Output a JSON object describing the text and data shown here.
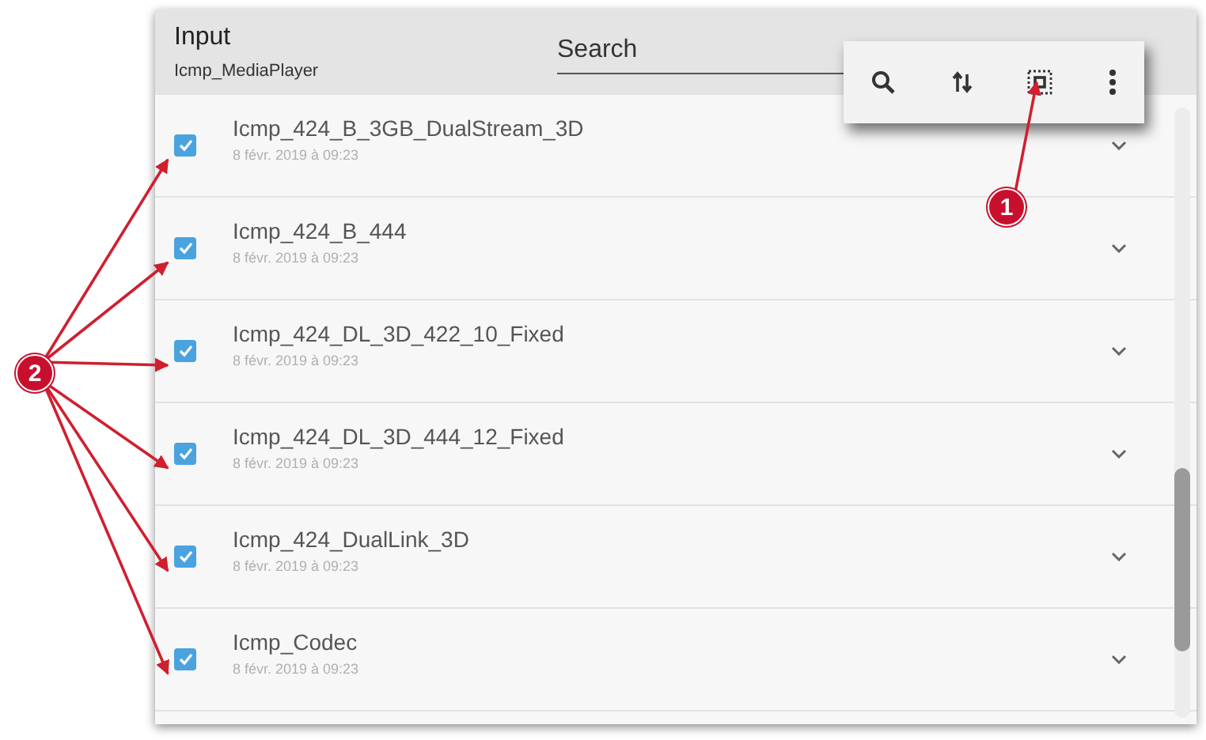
{
  "header": {
    "title": "Input",
    "subtitle": "Icmp_MediaPlayer"
  },
  "search": {
    "placeholder": "Search"
  },
  "toolbar": [
    {
      "kind": "search"
    },
    {
      "kind": "sort"
    },
    {
      "kind": "select"
    },
    {
      "kind": "more"
    }
  ],
  "items": [
    {
      "name": "Icmp_424_B_3GB_DualStream_3D",
      "date": "8 févr. 2019 à 09:23",
      "checked": true
    },
    {
      "name": "Icmp_424_B_444",
      "date": "8 févr. 2019 à 09:23",
      "checked": true
    },
    {
      "name": "Icmp_424_DL_3D_422_10_Fixed",
      "date": "8 févr. 2019 à 09:23",
      "checked": true
    },
    {
      "name": "Icmp_424_DL_3D_444_12_Fixed",
      "date": "8 févr. 2019 à 09:23",
      "checked": true
    },
    {
      "name": "Icmp_424_DualLink_3D",
      "date": "8 févr. 2019 à 09:23",
      "checked": true
    },
    {
      "name": "Icmp_Codec",
      "date": "8 févr. 2019 à 09:23",
      "checked": true
    }
  ],
  "callouts": [
    {
      "label": "1",
      "kind": "toolbar"
    },
    {
      "label": "2",
      "kind": "checkboxes"
    }
  ]
}
